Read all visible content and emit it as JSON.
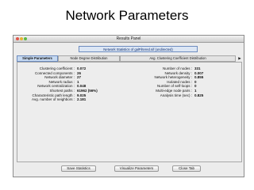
{
  "slide": {
    "title": "Network Parameters"
  },
  "window": {
    "title": "Results Panel"
  },
  "panel": {
    "header": "Network Statistics of galFiltered.sif (undirected)"
  },
  "tabs": [
    {
      "label": "Simple Parameters",
      "active": true
    },
    {
      "label": "Node Degree Distribution",
      "active": false
    },
    {
      "label": "Avg. Clustering Coefficient Distribution",
      "active": false
    }
  ],
  "tab_scroll_icon": "right-arrow-icon",
  "stats_left": [
    {
      "label": "Clustering coefficient :",
      "value": "0.072"
    },
    {
      "label": "Connected components :",
      "value": "26"
    },
    {
      "label": "Network diameter :",
      "value": "27"
    },
    {
      "label": "Network radius :",
      "value": "1"
    },
    {
      "label": "Network centralization :",
      "value": "0.048"
    },
    {
      "label": "Shortest paths :",
      "value": "61962 (56%)"
    },
    {
      "label": "Characteristic path length :",
      "value": "9.025"
    },
    {
      "label": "Avg. number of neighbors :",
      "value": "2.181"
    }
  ],
  "stats_right": [
    {
      "label": "Number of nodes :",
      "value": "331"
    },
    {
      "label": "Network density :",
      "value": "0.007"
    },
    {
      "label": "Network heterogeneity :",
      "value": "0.855"
    },
    {
      "label": "Isolated nodes :",
      "value": "0"
    },
    {
      "label": "Number of self-loops :",
      "value": "0"
    },
    {
      "label": "Multi-edge node pairs :",
      "value": "1"
    },
    {
      "label": "Analysis time (sec) :",
      "value": "0.825"
    }
  ],
  "buttons": {
    "save": "Save Statistics",
    "visualize": "Visualize Parameters",
    "close": "Close Tab"
  }
}
